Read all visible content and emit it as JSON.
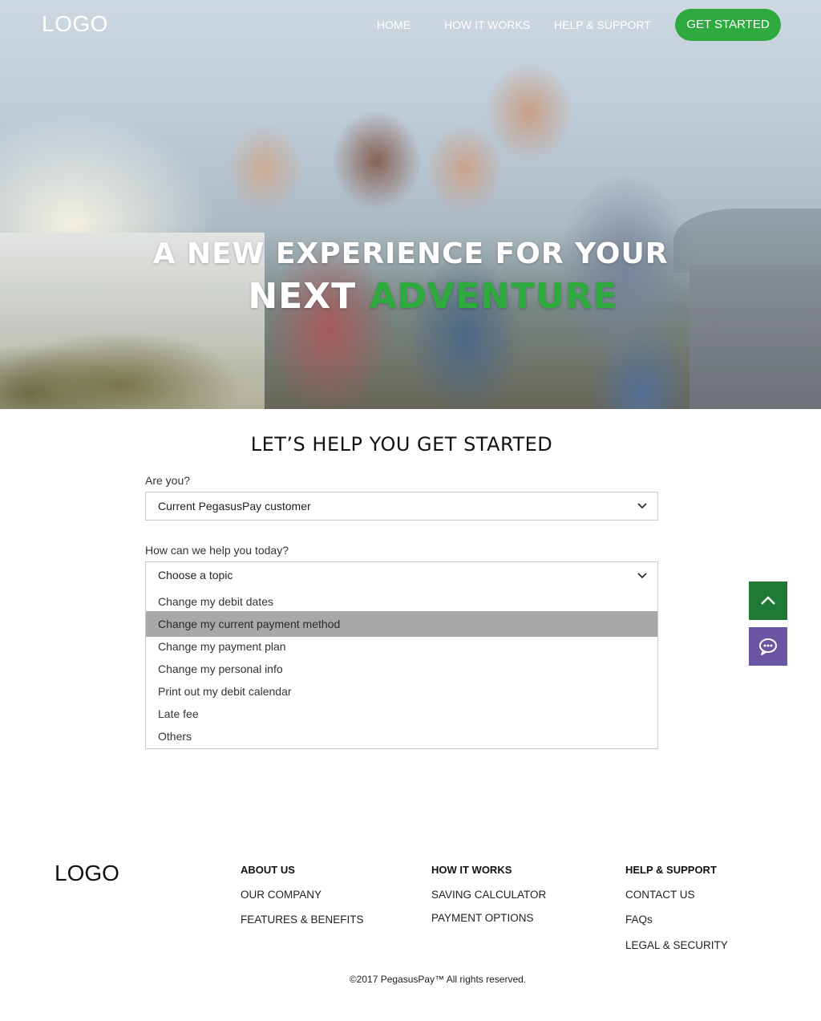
{
  "nav": {
    "logo": "LOGO",
    "links": [
      "HOME",
      "HOW IT WORKS",
      "HELP & SUPPORT"
    ],
    "cta": "GET STARTED"
  },
  "hero": {
    "line1": "A NEW EXPERIENCE FOR YOUR",
    "line2_plain": "NEXT",
    "line2_accent": "ADVENTURE"
  },
  "form": {
    "title": "LET’S HELP YOU GET STARTED",
    "q1_label": "Are you?",
    "q1_value": "Current PegasusPay customer",
    "q2_label": "How can we help you today?",
    "q2_value": "Choose a topic",
    "options": [
      "Change my debit dates",
      "Change my current payment method",
      "Change my payment plan",
      "Change my personal info",
      "Print out my debit calendar",
      "Late fee",
      "Others"
    ],
    "highlighted_option": "Change my current payment method"
  },
  "footer": {
    "logo": "LOGO",
    "about": {
      "heading": "ABOUT US",
      "links": [
        "OUR COMPANY",
        "FEATURES & BENEFITS"
      ]
    },
    "how": {
      "heading": "HOW IT WORKS",
      "links": [
        "SAVING CALCULATOR",
        "PAYMENT OPTIONS"
      ]
    },
    "help": {
      "heading": "HELP & SUPPORT",
      "links": [
        "CONTACT US",
        "FAQs",
        "LEGAL & SECURITY"
      ]
    },
    "copyright": "©2017 PegasusPay™ All rights reserved."
  },
  "colors": {
    "brand_green": "#2eaa3f",
    "dark_green": "#1e7a35",
    "chat_purple": "#6a55a3",
    "highlight_gray": "#a8a8a8"
  },
  "icons": [
    "chevron-down-icon",
    "chevron-up-icon",
    "chat-bubble-icon"
  ]
}
